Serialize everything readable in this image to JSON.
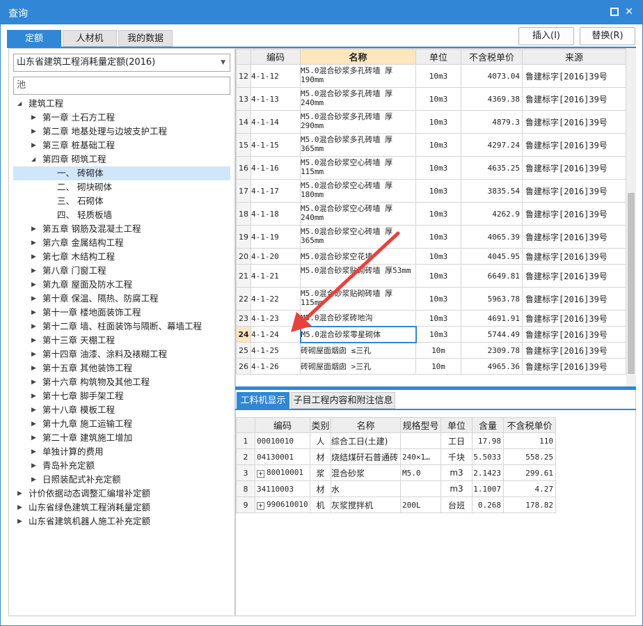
{
  "window": {
    "title": "查询"
  },
  "tabs": [
    "定额",
    "人材机",
    "我的数据"
  ],
  "buttons": {
    "insert": "插入(I)",
    "replace": "替换(R)"
  },
  "dropdown": {
    "value": "山东省建筑工程消耗量定额(2016)"
  },
  "search": {
    "value": "池"
  },
  "tree": [
    {
      "label": "建筑工程",
      "indent": 0,
      "expanded": true
    },
    {
      "label": "第一章 土石方工程",
      "indent": 1
    },
    {
      "label": "第二章 地基处理与边坡支护工程",
      "indent": 1
    },
    {
      "label": "第三章 桩基础工程",
      "indent": 1
    },
    {
      "label": "第四章 砌筑工程",
      "indent": 1,
      "expanded": true
    },
    {
      "label": "一、 砖砌体",
      "indent": 2,
      "selected": true
    },
    {
      "label": "二、 砌块砌体",
      "indent": 2
    },
    {
      "label": "三、 石砌体",
      "indent": 2
    },
    {
      "label": "四、 轻质板墙",
      "indent": 2
    },
    {
      "label": "第五章 钢筋及混凝土工程",
      "indent": 1
    },
    {
      "label": "第六章 金属结构工程",
      "indent": 1
    },
    {
      "label": "第七章 木结构工程",
      "indent": 1
    },
    {
      "label": "第八章 门窗工程",
      "indent": 1
    },
    {
      "label": "第九章 屋面及防水工程",
      "indent": 1
    },
    {
      "label": "第十章 保温、隔热、防腐工程",
      "indent": 1
    },
    {
      "label": "第十一章 楼地面装饰工程",
      "indent": 1
    },
    {
      "label": "第十二章 墙、柱面装饰与隔断、幕墙工程",
      "indent": 1
    },
    {
      "label": "第十三章 天棚工程",
      "indent": 1
    },
    {
      "label": "第十四章 油漆、涂料及裱糊工程",
      "indent": 1
    },
    {
      "label": "第十五章 其他装饰工程",
      "indent": 1
    },
    {
      "label": "第十六章 构筑物及其他工程",
      "indent": 1
    },
    {
      "label": "第十七章 脚手架工程",
      "indent": 1
    },
    {
      "label": "第十八章 模板工程",
      "indent": 1
    },
    {
      "label": "第十九章 施工运输工程",
      "indent": 1
    },
    {
      "label": "第二十章 建筑施工增加",
      "indent": 1
    },
    {
      "label": "单独计算的费用",
      "indent": 1
    },
    {
      "label": "青岛补充定额",
      "indent": 1
    },
    {
      "label": "日照装配式补充定额",
      "indent": 1
    },
    {
      "label": "计价依据动态调整汇编增补定额",
      "indent": 0
    },
    {
      "label": "山东省绿色建筑工程消耗量定额",
      "indent": 0
    },
    {
      "label": "山东省建筑机器人施工补充定额",
      "indent": 0
    }
  ],
  "quota_table": {
    "headers": [
      "编码",
      "名称",
      "单位",
      "不含税单价",
      "来源"
    ],
    "rows": [
      {
        "no": "12",
        "code": "4-1-12",
        "name": "M5.0混合砂浆多孔砖墙 厚190mm",
        "unit": "10m3",
        "price": "4073.04",
        "source": "鲁建标字[2016]39号"
      },
      {
        "no": "13",
        "code": "4-1-13",
        "name": "M5.0混合砂浆多孔砖墙 厚240mm",
        "unit": "10m3",
        "price": "4369.38",
        "source": "鲁建标字[2016]39号"
      },
      {
        "no": "14",
        "code": "4-1-14",
        "name": "M5.0混合砂浆多孔砖墙 厚290mm",
        "unit": "10m3",
        "price": "4879.3",
        "source": "鲁建标字[2016]39号"
      },
      {
        "no": "15",
        "code": "4-1-15",
        "name": "M5.0混合砂浆多孔砖墙 厚365mm",
        "unit": "10m3",
        "price": "4297.24",
        "source": "鲁建标字[2016]39号"
      },
      {
        "no": "16",
        "code": "4-1-16",
        "name": "M5.0混合砂浆空心砖墙 厚115mm",
        "unit": "10m3",
        "price": "4635.25",
        "source": "鲁建标字[2016]39号"
      },
      {
        "no": "17",
        "code": "4-1-17",
        "name": "M5.0混合砂浆空心砖墙 厚180mm",
        "unit": "10m3",
        "price": "3835.54",
        "source": "鲁建标字[2016]39号"
      },
      {
        "no": "18",
        "code": "4-1-18",
        "name": "M5.0混合砂浆空心砖墙 厚240mm",
        "unit": "10m3",
        "price": "4262.9",
        "source": "鲁建标字[2016]39号"
      },
      {
        "no": "19",
        "code": "4-1-19",
        "name": "M5.0混合砂浆空心砖墙 厚365mm",
        "unit": "10m3",
        "price": "4065.39",
        "source": "鲁建标字[2016]39号"
      },
      {
        "no": "20",
        "code": "4-1-20",
        "name": "M5.0混合砂浆空花墙",
        "unit": "10m3",
        "price": "4045.95",
        "source": "鲁建标字[2016]39号",
        "short": true
      },
      {
        "no": "21",
        "code": "4-1-21",
        "name": "M5.0混合砂浆贴砌砖墙 厚53mm",
        "unit": "10m3",
        "price": "6649.81",
        "source": "鲁建标字[2016]39号"
      },
      {
        "no": "22",
        "code": "4-1-22",
        "name": "M5.0混合砂浆贴砌砖墙 厚115mm",
        "unit": "10m3",
        "price": "5963.78",
        "source": "鲁建标字[2016]39号"
      },
      {
        "no": "23",
        "code": "4-1-23",
        "name": "M5.0混合砂浆砖地沟",
        "unit": "10m3",
        "price": "4691.91",
        "source": "鲁建标字[2016]39号",
        "short": true
      },
      {
        "no": "24",
        "code": "4-1-24",
        "name": "M5.0混合砂浆零星砌体",
        "unit": "10m3",
        "price": "5744.49",
        "source": "鲁建标字[2016]39号",
        "short": true,
        "current": true
      },
      {
        "no": "25",
        "code": "4-1-25",
        "name": "砖砌屋面烟囱 ≤三孔",
        "unit": "10m",
        "price": "2309.78",
        "source": "鲁建标字[2016]39号",
        "short": true
      },
      {
        "no": "26",
        "code": "4-1-26",
        "name": "砖砌屋面烟囱 >三孔",
        "unit": "10m",
        "price": "4965.36",
        "source": "鲁建标字[2016]39号",
        "short": true
      }
    ]
  },
  "bottom_tabs": [
    "工料机显示",
    "子目工程内容和附注信息"
  ],
  "material_table": {
    "headers": [
      "编码",
      "类别",
      "名称",
      "规格型号",
      "单位",
      "含量",
      "不含税单价"
    ],
    "rows": [
      {
        "no": "1",
        "code": "00010010",
        "cat": "人",
        "name": "综合工日(土建)",
        "spec": "",
        "unit": "工日",
        "qty": "17.98",
        "price": "110"
      },
      {
        "no": "2",
        "code": "04130001",
        "cat": "材",
        "name": "烧结煤矸石普通砖",
        "spec": "240×1…",
        "unit": "千块",
        "qty": "5.5033",
        "price": "558.25"
      },
      {
        "no": "3",
        "code": "80010001",
        "cat": "浆",
        "name": "混合砂浆",
        "spec": "M5.0",
        "unit": "m3",
        "qty": "2.1423",
        "price": "299.61",
        "plus": true
      },
      {
        "no": "8",
        "code": "34110003",
        "cat": "材",
        "name": "水",
        "spec": "",
        "unit": "m3",
        "qty": "1.1007",
        "price": "4.27"
      },
      {
        "no": "9",
        "code": "990610010",
        "cat": "机",
        "name": "灰浆搅拌机",
        "spec": "200L",
        "unit": "台班",
        "qty": "0.268",
        "price": "178.82",
        "plus": true
      }
    ]
  },
  "colors": {
    "accent": "#3187d6",
    "annotation_arrow": "#e8413d",
    "highlight": "#fbe6bd",
    "selection": "#cfe6fb"
  }
}
